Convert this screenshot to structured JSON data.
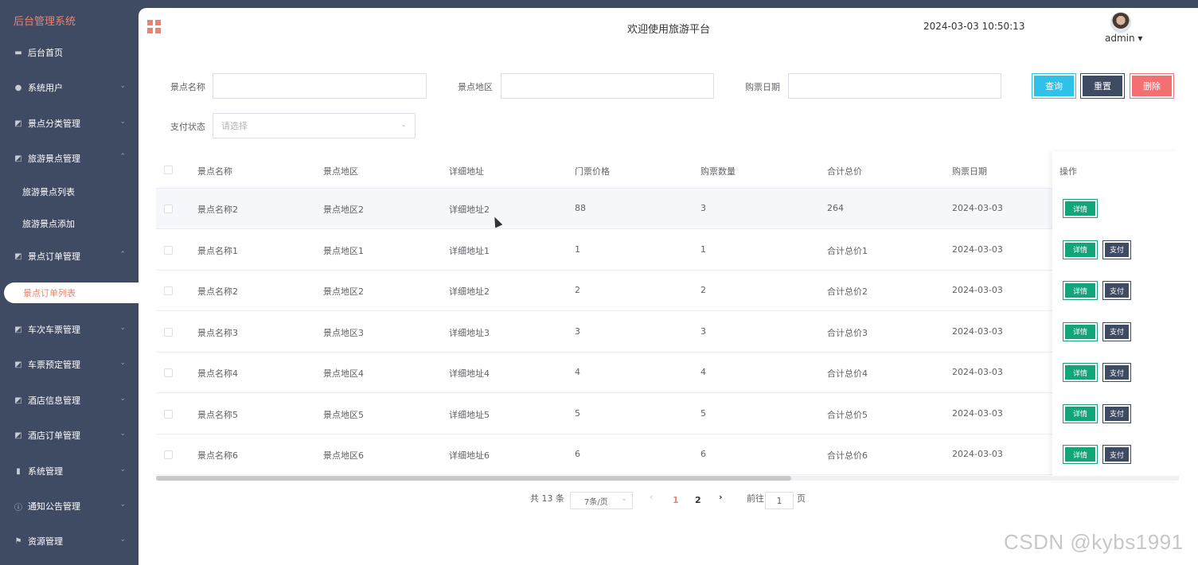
{
  "sidebar": {
    "brand": "后台管理系统",
    "items": [
      {
        "label": "后台首页",
        "icon": "monitor-icon",
        "arrow": ""
      },
      {
        "label": "系统用户",
        "icon": "user-icon",
        "arrow": "⌄"
      },
      {
        "label": "景点分类管理",
        "icon": "chart-icon",
        "arrow": "⌄"
      },
      {
        "label": "旅游景点管理",
        "icon": "chart-icon",
        "arrow": "⌃"
      },
      {
        "label": "景点订单管理",
        "icon": "chart-icon",
        "arrow": "⌃"
      },
      {
        "label": "车次车票管理",
        "icon": "chart-icon",
        "arrow": "⌄"
      },
      {
        "label": "车票预定管理",
        "icon": "chart-icon",
        "arrow": "⌄"
      },
      {
        "label": "酒店信息管理",
        "icon": "chart-icon",
        "arrow": "⌄"
      },
      {
        "label": "酒店订单管理",
        "icon": "chart-icon",
        "arrow": "⌄"
      },
      {
        "label": "系统管理",
        "icon": "bar-chart-icon",
        "arrow": "⌄"
      },
      {
        "label": "通知公告管理",
        "icon": "info-icon",
        "arrow": "⌄"
      },
      {
        "label": "资源管理",
        "icon": "flag-icon",
        "arrow": "⌄"
      }
    ],
    "sub_attractions": [
      "旅游景点列表",
      "旅游景点添加"
    ],
    "sub_orders_active": "景点订单列表"
  },
  "header": {
    "welcome": "欢迎使用旅游平台",
    "datetime": "2024-03-03 10:50:13",
    "user": "admin ▾"
  },
  "search": {
    "name_label": "景点名称",
    "region_label": "景点地区",
    "date_label": "购票日期",
    "pay_label": "支付状态",
    "pay_placeholder": "请选择",
    "query": "查询",
    "reset": "重置",
    "delete": "删除"
  },
  "table": {
    "headers": [
      "景点名称",
      "景点地区",
      "详细地址",
      "门票价格",
      "购票数量",
      "合计总价",
      "购票日期",
      "操作"
    ],
    "detail_label": "详情",
    "pay_label": "支付",
    "rows": [
      [
        "景点名称2",
        "景点地区2",
        "详细地址2",
        "88",
        "3",
        "264",
        "2024-03-03"
      ],
      [
        "景点名称1",
        "景点地区1",
        "详细地址1",
        "1",
        "1",
        "合计总价1",
        "2024-03-03"
      ],
      [
        "景点名称2",
        "景点地区2",
        "详细地址2",
        "2",
        "2",
        "合计总价2",
        "2024-03-03"
      ],
      [
        "景点名称3",
        "景点地区3",
        "详细地址3",
        "3",
        "3",
        "合计总价3",
        "2024-03-03"
      ],
      [
        "景点名称4",
        "景点地区4",
        "详细地址4",
        "4",
        "4",
        "合计总价4",
        "2024-03-03"
      ],
      [
        "景点名称5",
        "景点地区5",
        "详细地址5",
        "5",
        "5",
        "合计总价5",
        "2024-03-03"
      ],
      [
        "景点名称6",
        "景点地区6",
        "详细地址6",
        "6",
        "6",
        "合计总价6",
        "2024-03-03"
      ]
    ]
  },
  "pagination": {
    "total": "共 13 条",
    "page_size": "7条/页",
    "pages": [
      "1",
      "2"
    ],
    "current": "1",
    "goto_prefix": "前往",
    "goto_value": "1",
    "goto_suffix": "页"
  },
  "watermark": "CSDN @kybs1991",
  "colors": {
    "sidebar": "#3f4a63",
    "accent": "#f2816b",
    "query": "#2ec2ea",
    "delete": "#f46f72",
    "detail": "#13a57a"
  }
}
